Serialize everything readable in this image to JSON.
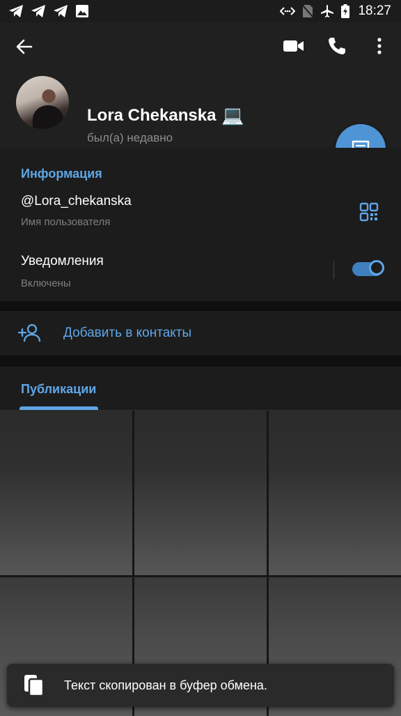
{
  "status_bar": {
    "time": "18:27",
    "left_icons": [
      "telegram-icon",
      "telegram-icon",
      "telegram-icon",
      "image-icon"
    ],
    "right_icons": [
      "data-saver-icon",
      "no-sim-icon",
      "airplane-icon",
      "battery-charging-icon"
    ]
  },
  "header": {
    "name": "Lora Chekanska",
    "emoji": "💻",
    "last_seen": "был(а) недавно"
  },
  "info": {
    "section_title": "Информация",
    "username": "@Lora_chekanska",
    "username_label": "Имя пользователя",
    "notifications_label": "Уведомления",
    "notifications_value": "Включены",
    "notifications_on": true
  },
  "add_contact": {
    "label": "Добавить в контакты"
  },
  "publications": {
    "tab_label": "Публикации",
    "tile_count": 6
  },
  "toast": {
    "text": "Текст скопирован в буфер обмена."
  },
  "colors": {
    "accent": "#5fa6e8",
    "fab": "#4f95d6",
    "background": "#1c1c1c"
  }
}
